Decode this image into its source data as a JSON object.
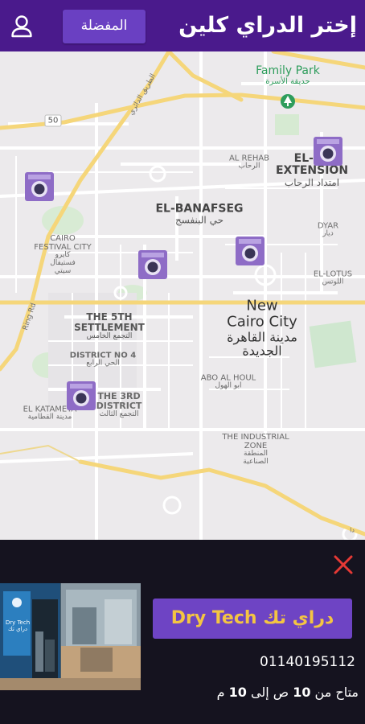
{
  "header": {
    "title": "إختر الدراي كلين",
    "favorites_label": "المفضلة",
    "background": "#4a1a8c",
    "button_color": "#6a40c2"
  },
  "map": {
    "labels": {
      "family_park": "Family Park",
      "family_park_ar": "حديقة الأسرة",
      "el_rehab": "AL REHAB",
      "el_rehab_ar": "الرحاب",
      "el_rehab_ext": "EL-REHAB EXTENSION",
      "el_rehab_ext_line1": "EL-RE",
      "el_rehab_ext_line2": "EXTENSION",
      "el_rehab_ext_ar": "امتداد الرحاب",
      "el_banafseg": "EL-BANAFSEG",
      "el_banafseg_ar": "حي البنفسج",
      "dyar": "DYAR",
      "dyar_ar": "ديار",
      "cairo_festival": "CAIRO FESTIVAL CITY",
      "cairo_festival_line1": "CAIRO",
      "cairo_festival_line2": "FESTIVAL CITY",
      "cairo_festival_ar": "كايرو فستيفال سيتي",
      "cairo_festival_ar1": "كايرو",
      "cairo_festival_ar2": "فستيفال",
      "cairo_festival_ar3": "سيتي",
      "el_lotus": "EL-LOTUS",
      "el_lotus_ar": "اللوتس",
      "new_cairo": "New Cairo City",
      "new_cairo_line1": "New",
      "new_cairo_line2": "Cairo City",
      "new_cairo_ar": "مدينة القاهرة الجديدة",
      "new_cairo_ar1": "مدينة القاهرة",
      "new_cairo_ar2": "الجديدة",
      "fifth_settlement": "THE 5TH SETTLEMENT",
      "fifth_settlement_line1": "THE 5TH",
      "fifth_settlement_line2": "SETTLEMENT",
      "fifth_settlement_ar": "التجمع الخامس",
      "district_4": "DISTRICT NO 4",
      "district_4_ar": "الحي الرابع",
      "abo_al_houl": "ABO AL HOUL",
      "abo_al_houl_ar": "ابو الهول",
      "third_district": "THE 3RD DISTRICT",
      "third_district_line1": "THE 3RD",
      "third_district_line2": "DISTRICT",
      "third_district_ar": "التجمع الثالث",
      "el_katameya": "EL KATAMEYA",
      "el_katameya_ar": "مدينة القطامية",
      "industrial_zone": "THE INDUSTRIAL ZONE",
      "industrial_zone_line1": "THE INDUSTRIAL",
      "industrial_zone_line2": "ZONE",
      "industrial_zone_ar": "المنطقة الصناعية",
      "industrial_zone_ar1": "المنطقة",
      "industrial_zone_ar2": "الصناعية",
      "road_50": "50",
      "ring_rd": "Ring Rd",
      "road_name_top": "الطريق الدائري",
      "road_fragment": "دا"
    },
    "marker_icon": "washing-machine-icon",
    "marker_color": "#8e6cc6"
  },
  "card": {
    "name": "دراي تك  Dry Tech",
    "phone": "01140195112",
    "hours_prefix": "متاح من ",
    "hours_from": "10",
    "hours_mid": " ص إلى ",
    "hours_to": "10",
    "hours_suffix": " م",
    "photo_sign_top": "Dry Tech",
    "photo_sign_bottom": "دراي تك",
    "close_icon": "close-icon",
    "close_color": "#e53935",
    "name_color": "#f4c542",
    "badge_color": "#6e44c4"
  }
}
